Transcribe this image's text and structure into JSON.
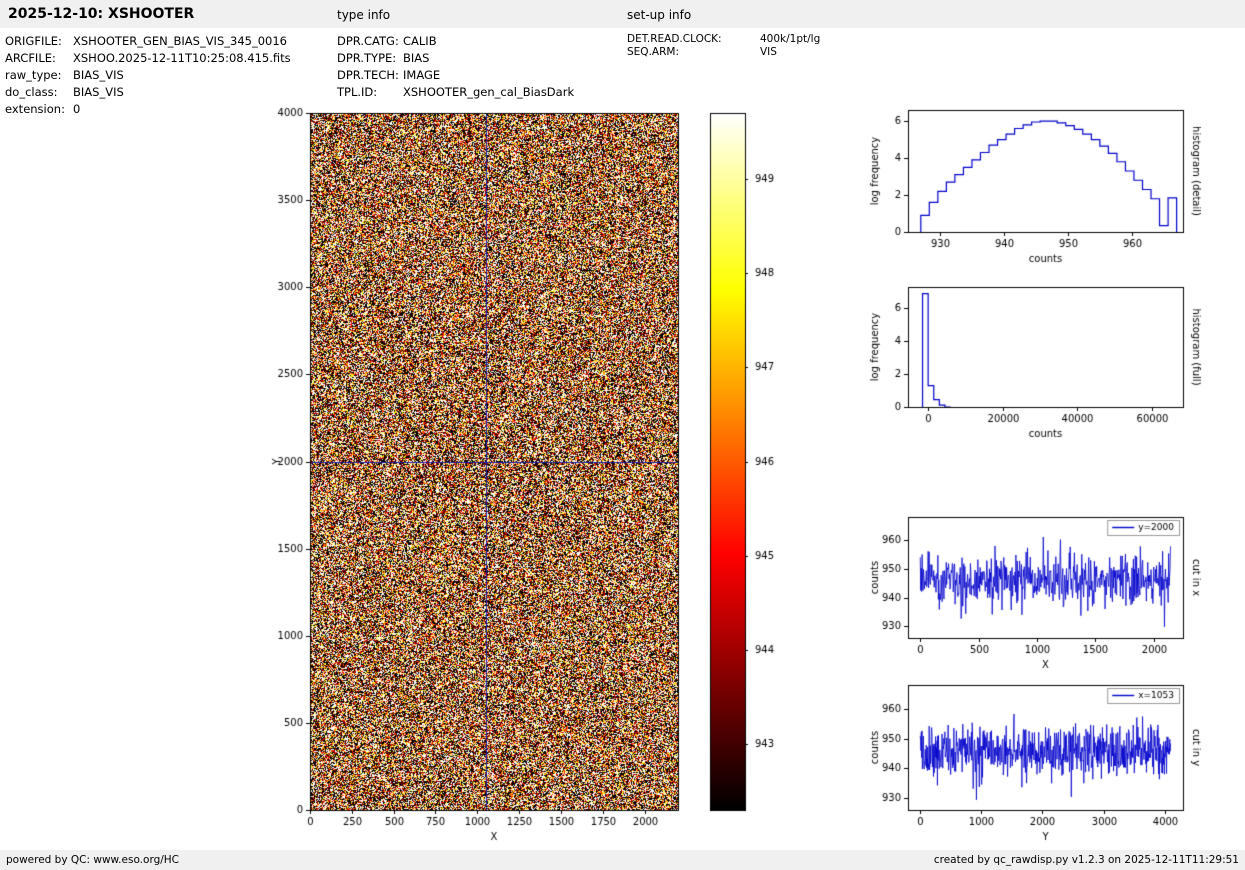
{
  "header": {
    "title": "2025-12-10: XSHOOTER",
    "type_info_label": "type info",
    "setup_info_label": "set-up info"
  },
  "file_info": {
    "rows": [
      {
        "label": "ORIGFILE:",
        "value": "XSHOOTER_GEN_BIAS_VIS_345_0016"
      },
      {
        "label": "ARCFILE:",
        "value": "XSHOO.2025-12-11T10:25:08.415.fits"
      },
      {
        "label": "raw_type:",
        "value": "BIAS_VIS"
      },
      {
        "label": "do_class:",
        "value": "BIAS_VIS"
      },
      {
        "label": "extension:",
        "value": "0"
      }
    ]
  },
  "type_info": {
    "rows": [
      {
        "label": "DPR.CATG:",
        "value": "CALIB"
      },
      {
        "label": "DPR.TYPE:",
        "value": "BIAS"
      },
      {
        "label": "DPR.TECH:",
        "value": "IMAGE"
      },
      {
        "label": "TPL.ID:",
        "value": "XSHOOTER_gen_cal_BiasDark"
      }
    ]
  },
  "setup_info": {
    "rows": [
      {
        "label": "DET.READ.CLOCK:",
        "value": "400k/1pt/lg"
      },
      {
        "label": "SEQ.ARM:",
        "value": "VIS"
      }
    ]
  },
  "footer": {
    "left": "powered by QC: www.eso.org/HC",
    "right": "created by qc_rawdisp.py v1.2.3 on 2025-12-11T11:29:51"
  },
  "chart_data": [
    {
      "name": "bias-image",
      "type": "heatmap",
      "xlabel": "X",
      "ylabel": "Y",
      "xlim": [
        0,
        2200
      ],
      "ylim": [
        0,
        4000
      ],
      "xticks": [
        0,
        250,
        500,
        750,
        1000,
        1250,
        1500,
        1750,
        2000
      ],
      "yticks": [
        0,
        500,
        1000,
        1500,
        2000,
        2500,
        3000,
        3500,
        4000
      ],
      "crosshair": {
        "x": 1053,
        "y": 2000
      },
      "crosshair_color": "#1a1aa6",
      "noise": {
        "mean": 945.5,
        "sd": 6.0,
        "seed": 11
      },
      "clim": [
        942.3,
        949.7
      ],
      "colormap": "hot"
    },
    {
      "name": "colorbar",
      "type": "colorbar",
      "colormap": "hot",
      "clim": [
        942.3,
        949.7
      ],
      "ticks": [
        943,
        944,
        945,
        946,
        947,
        948,
        949
      ]
    },
    {
      "name": "histogram-detail",
      "type": "step",
      "color": "#0000cc",
      "xlabel": "counts",
      "ylabel": "log frequency",
      "right_label": "histogram (detail)",
      "xlim": [
        925,
        968
      ],
      "ylim": [
        0,
        6.6
      ],
      "xticks": [
        930,
        940,
        950,
        960
      ],
      "yticks": [
        0,
        2,
        4,
        6
      ],
      "bin_edges": [
        927,
        928.33,
        929.67,
        931,
        932.33,
        933.67,
        935,
        936.33,
        937.67,
        939,
        940.33,
        941.67,
        943,
        944.33,
        945.67,
        947,
        948.33,
        949.67,
        951,
        952.33,
        953.67,
        955,
        956.33,
        957.67,
        959,
        960.33,
        961.67,
        963,
        964.33,
        965.67,
        967
      ],
      "values": [
        0.9,
        1.6,
        2.2,
        2.7,
        3.1,
        3.5,
        3.9,
        4.3,
        4.7,
        5.0,
        5.3,
        5.6,
        5.8,
        5.95,
        6.0,
        6.0,
        5.9,
        5.75,
        5.55,
        5.3,
        5.0,
        4.65,
        4.25,
        3.8,
        3.3,
        2.8,
        2.3,
        1.8,
        0.35,
        1.85
      ]
    },
    {
      "name": "histogram-full",
      "type": "step",
      "color": "#0000cc",
      "xlabel": "counts",
      "ylabel": "log frequency",
      "right_label": "histogram (full)",
      "xlim": [
        -5400,
        68300
      ],
      "ylim": [
        0,
        7.3
      ],
      "xticks": [
        0,
        20000,
        40000,
        60000
      ],
      "yticks": [
        0,
        2,
        4,
        6
      ],
      "bin_edges": [
        -1500,
        0,
        1500,
        3000,
        4500,
        6000
      ],
      "values": [
        6.9,
        1.3,
        0.45,
        0.12,
        0
      ]
    },
    {
      "name": "cut-x",
      "type": "noisy-line",
      "color": "#0000cc",
      "xlabel": "X",
      "ylabel": "counts",
      "right_label": "cut in x",
      "legend": "y=2000",
      "xlim": [
        -105,
        2250
      ],
      "ylim": [
        926,
        968
      ],
      "xticks": [
        0,
        500,
        1000,
        1500,
        2000
      ],
      "yticks": [
        930,
        940,
        950,
        960
      ],
      "x_range": [
        0,
        2143
      ],
      "n": 540,
      "mean": 945.5,
      "sd": 4.3,
      "seed": 23
    },
    {
      "name": "cut-y",
      "type": "noisy-line",
      "color": "#0000cc",
      "xlabel": "Y",
      "ylabel": "counts",
      "right_label": "cut in y",
      "legend": "x=1053",
      "xlim": [
        -200,
        4300
      ],
      "ylim": [
        926,
        968
      ],
      "xticks": [
        0,
        1000,
        2000,
        3000,
        4000
      ],
      "yticks": [
        930,
        940,
        950,
        960
      ],
      "x_range": [
        0,
        4095
      ],
      "n": 700,
      "mean": 945.5,
      "sd": 4.3,
      "seed": 77
    }
  ]
}
